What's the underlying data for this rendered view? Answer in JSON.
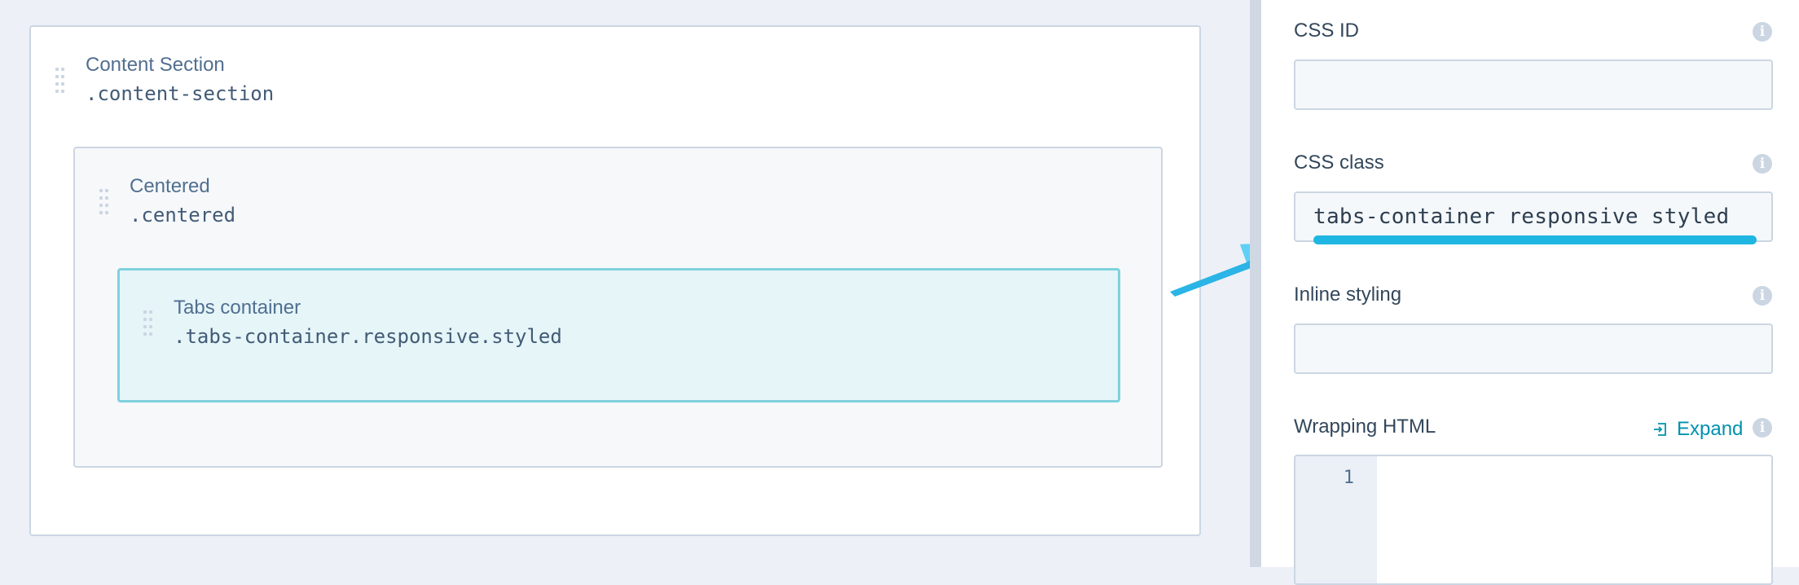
{
  "canvas": {
    "content_section": {
      "label": "Content Section",
      "class": ".content-section"
    },
    "centered": {
      "label": "Centered",
      "class": ".centered"
    },
    "tabs_container": {
      "label": "Tabs container",
      "class": ".tabs-container.responsive.styled"
    }
  },
  "panel": {
    "css_id": {
      "label": "CSS ID",
      "value": ""
    },
    "css_class": {
      "label": "CSS class",
      "value": "tabs-container responsive styled"
    },
    "inline_styling": {
      "label": "Inline styling",
      "value": ""
    },
    "wrapping_html": {
      "label": "Wrapping HTML",
      "expand_label": "Expand",
      "line_number": "1"
    },
    "info_icon_glyph": "i"
  },
  "colors": {
    "accent_cyan": "#1fb6e1",
    "selected_border": "#7fd1de",
    "selected_fill": "#e5f5f8",
    "link": "#0091ae"
  },
  "icons": [
    "drag-handle-icon",
    "info-icon",
    "expand-icon",
    "pointer-arrow"
  ]
}
